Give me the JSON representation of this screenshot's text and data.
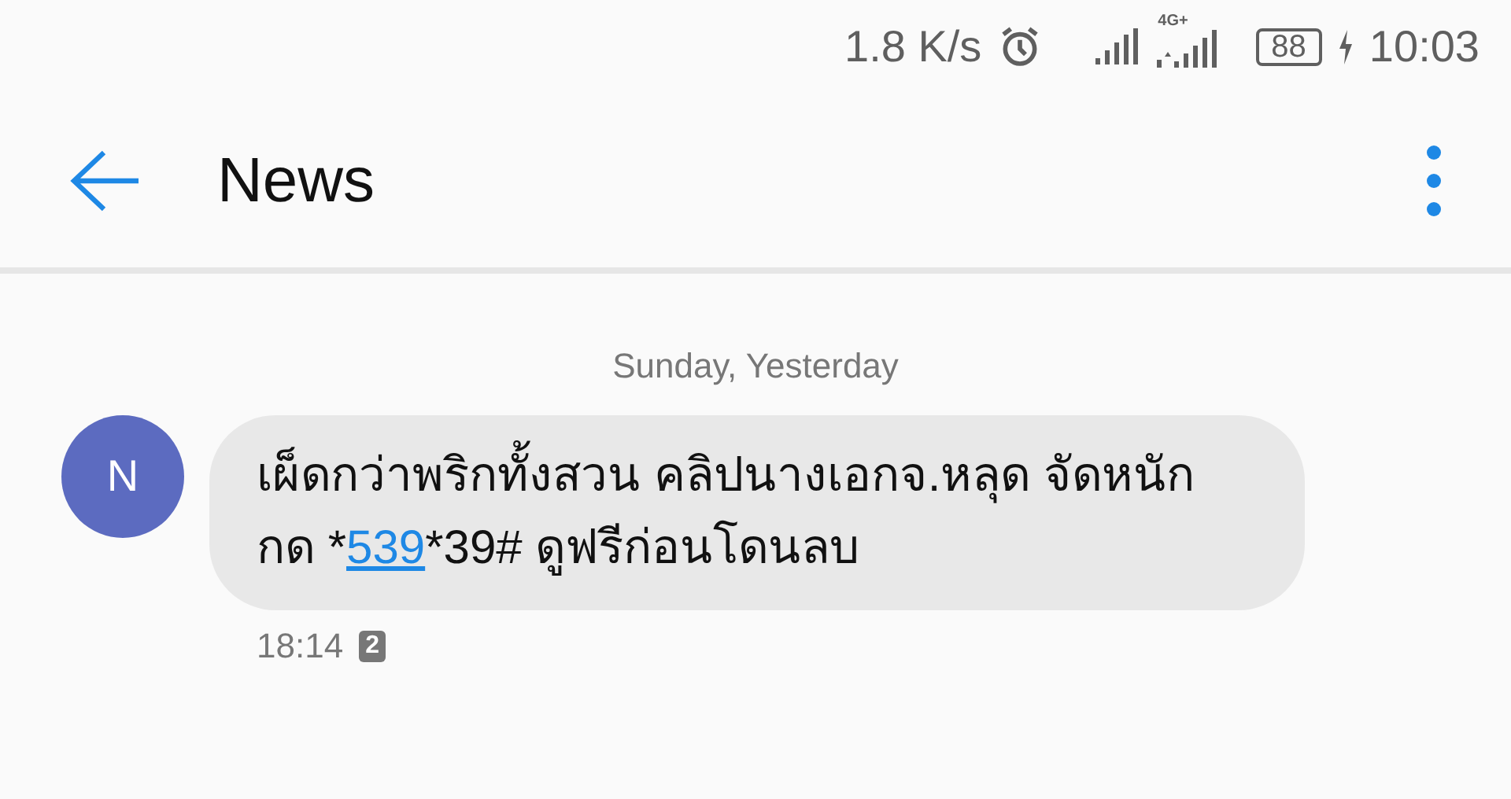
{
  "status_bar": {
    "speed": "1.8 K/s",
    "network": "4G+",
    "battery": "88",
    "time": "10:03"
  },
  "app_bar": {
    "title": "News"
  },
  "date_header": "Sunday, Yesterday",
  "messages": [
    {
      "avatar": "N",
      "parts": [
        {
          "kind": "text",
          "text": "เผ็ดกว่าพริกทั้งสวน คลิปนางเอกจ.หลุด จัดหนัก กด *"
        },
        {
          "kind": "link",
          "text": "539"
        },
        {
          "kind": "text",
          "text": "*39# ดูฟรีก่อนโดนลบ"
        }
      ],
      "time": "18:14",
      "sim": "2"
    }
  ]
}
